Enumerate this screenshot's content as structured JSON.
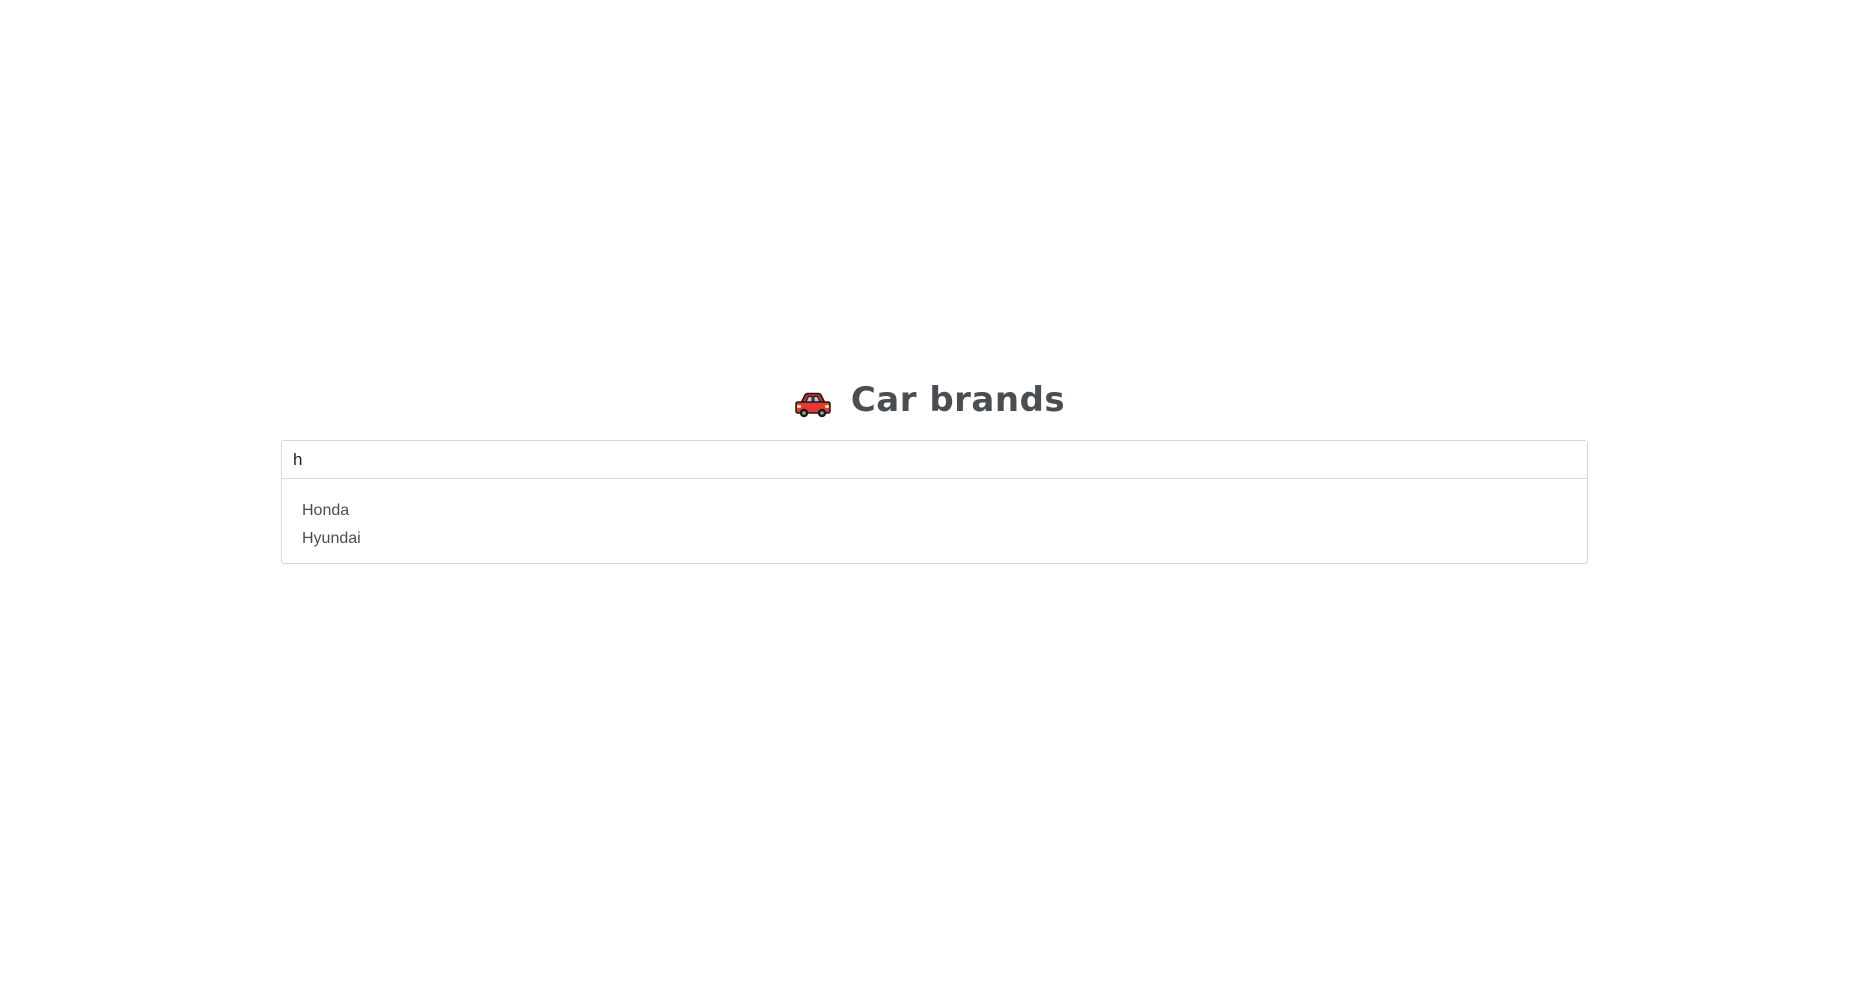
{
  "header": {
    "icon": "red-car-icon",
    "title": "Car brands"
  },
  "search": {
    "value": "h",
    "placeholder": ""
  },
  "results": [
    {
      "label": "Honda"
    },
    {
      "label": "Hyundai"
    }
  ],
  "colors": {
    "text": "#4a4d52",
    "border": "#d8d8d8",
    "car_body": "#e53935",
    "car_window": "#9fd3ef"
  }
}
